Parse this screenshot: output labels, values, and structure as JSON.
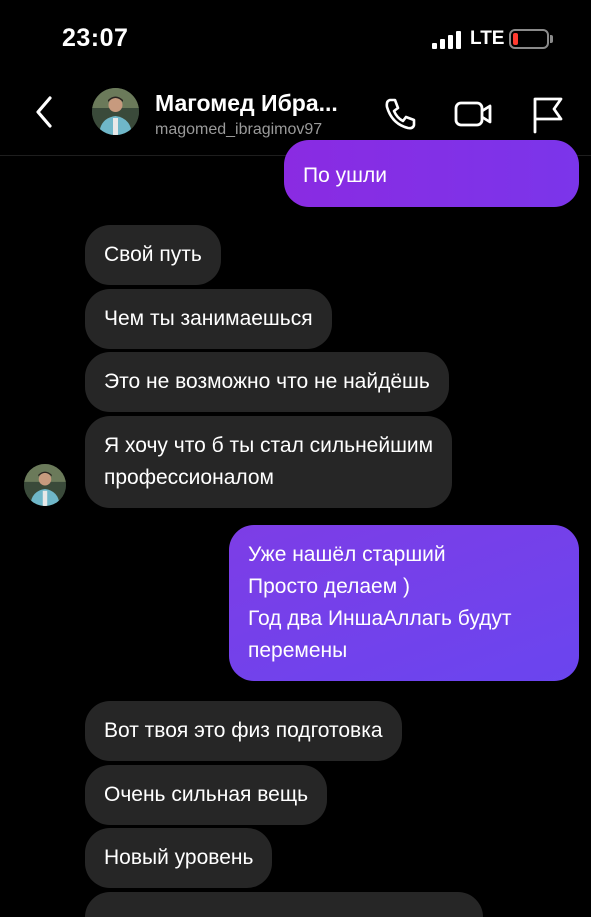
{
  "status_bar": {
    "time": "23:07",
    "network": "LTE",
    "battery_color": "#ff3b30",
    "battery_level": 0.15
  },
  "header": {
    "name": "Магомед Ибра...",
    "username": "magomed_ibragimov97",
    "icons": [
      "back-chevron-icon",
      "phone-icon",
      "video-camera-icon",
      "flag-icon"
    ]
  },
  "messages": [
    {
      "direction": "out",
      "lines": [
        "По ушли"
      ]
    },
    {
      "direction": "in",
      "lines": [
        "Свой путь"
      ]
    },
    {
      "direction": "in",
      "lines": [
        "Чем ты занимаешься"
      ]
    },
    {
      "direction": "in",
      "lines": [
        "Это не возможно что не найдёшь"
      ]
    },
    {
      "direction": "in",
      "lines": [
        "Я хочу что б ты стал сильнейшим",
        "профессионалом"
      ]
    },
    {
      "direction": "out",
      "lines": [
        "Уже нашёл старший",
        "Просто делаем )",
        "Год два ИншаАллагь будут",
        "перемены"
      ]
    },
    {
      "direction": "in",
      "lines": [
        "Вот твоя это физ подготовка"
      ]
    },
    {
      "direction": "in",
      "lines": [
        "Очень сильная вещь"
      ]
    },
    {
      "direction": "in",
      "lines": [
        "Новый уровень"
      ]
    }
  ],
  "colors": {
    "background": "#000000",
    "incoming_bubble": "#262626",
    "outgoing_bubble_start": "#8a2be2",
    "outgoing_bubble_end": "#6a45ef",
    "username": "#9a9a9a"
  }
}
